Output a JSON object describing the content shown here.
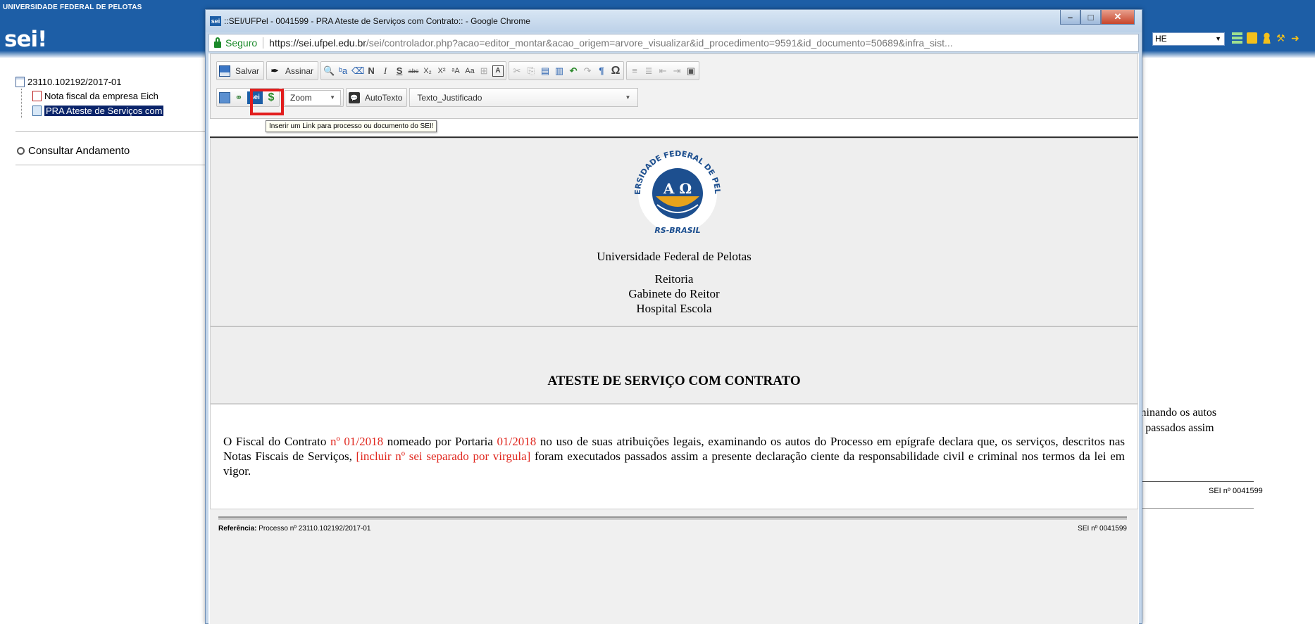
{
  "app": {
    "university": "UNIVERSIDADE FEDERAL DE PELOTAS",
    "logo": "sei!",
    "unit_selected": "HE",
    "header_icons": [
      "list-icon",
      "notes-icon",
      "user-icon",
      "wrench-icon",
      "exit-icon"
    ]
  },
  "tree": {
    "process_number": "23110.102192/2017-01",
    "items": [
      {
        "label": "Nota fiscal da empresa Eich",
        "icon": "pdf-icon"
      },
      {
        "label": "PRA Ateste de Serviços com",
        "icon": "document-icon",
        "selected": true
      }
    ],
    "consultar": "Consultar Andamento"
  },
  "background_doc": {
    "line1": "xaminando os autos",
    "line2": "dos passados assim",
    "sei_ref": "SEI nº 0041599"
  },
  "window": {
    "title": "::SEI/UFPel - 0041599 - PRA Ateste de Serviços com Contrato:: - Google Chrome",
    "favicon": "sei",
    "secure_label": "Seguro",
    "url_host": "https://sei.ufpel.edu.br",
    "url_path": "/sei/controlador.php?acao=editor_montar&acao_origem=arvore_visualizar&id_procedimento=9591&id_documento=50689&infra_sist..."
  },
  "toolbar": {
    "save_label": "Salvar",
    "sign_label": "Assinar",
    "row1_icons": [
      "find-icon",
      "replace-icon",
      "eraser-icon",
      "bold-icon",
      "italic-icon",
      "underline-icon",
      "strikethrough-icon",
      "subscript-icon",
      "superscript-icon",
      "uppercase-icon",
      "lowercase-icon",
      "table-icon",
      "text-color-icon",
      "cut-icon",
      "copy-icon",
      "paste-icon",
      "paste-word-icon",
      "undo-icon",
      "redo-icon",
      "paragraph-icon",
      "omega-icon",
      "numbered-list-icon",
      "bullet-list-icon",
      "outdent-icon",
      "indent-icon",
      "image-icon"
    ],
    "row1_glyphs": [
      "🔍",
      "ᵇa",
      "⌫",
      "N",
      "I",
      "S",
      "abc",
      "X₂",
      "X²",
      "ᵃA",
      "Aa",
      "⊞",
      "A",
      "✂",
      "⎘",
      "▤",
      "▥",
      "↶",
      "↷",
      "¶",
      "Ω",
      "≡",
      "≣",
      "⇤",
      "⇥",
      "▣"
    ],
    "sei_button": "sei",
    "zoom_label": "Zoom",
    "autotexto_label": "AutoTexto",
    "style_value": "Texto_Justificado",
    "tooltip": "Inserir um Link para processo ou documento do SEI!"
  },
  "document": {
    "seal_top": "UNIVERSIDADE FEDERAL DE PELOTAS",
    "seal_bottom": "RS-BRASIL",
    "seal_letters": "A Ω",
    "university": "Universidade Federal de Pelotas",
    "header_lines": [
      "Reitoria",
      "Gabinete do Reitor",
      "Hospital Escola"
    ],
    "title": "ATESTE DE SERVIÇO COM CONTRATO",
    "body": {
      "p1": "O Fiscal do Contrato ",
      "r1": "nº 01/2018",
      "p2": " nomeado por Portaria ",
      "r2": "01/2018",
      "p3": " no uso de suas atribuições legais, examinando os autos do Processo em epígrafe declara que, os serviços, descritos nas Notas Fiscais de Serviços, ",
      "r3": "[incluir nº sei separado por virgula]",
      "p4": " foram executados passados assim a presente declaração ciente da responsabilidade civil e criminal nos termos da lei em vigor."
    },
    "footer_ref_label": "Referência:",
    "footer_ref_value": " Processo nº 23110.102192/2017-01",
    "footer_sei": "SEI nº 0041599"
  }
}
